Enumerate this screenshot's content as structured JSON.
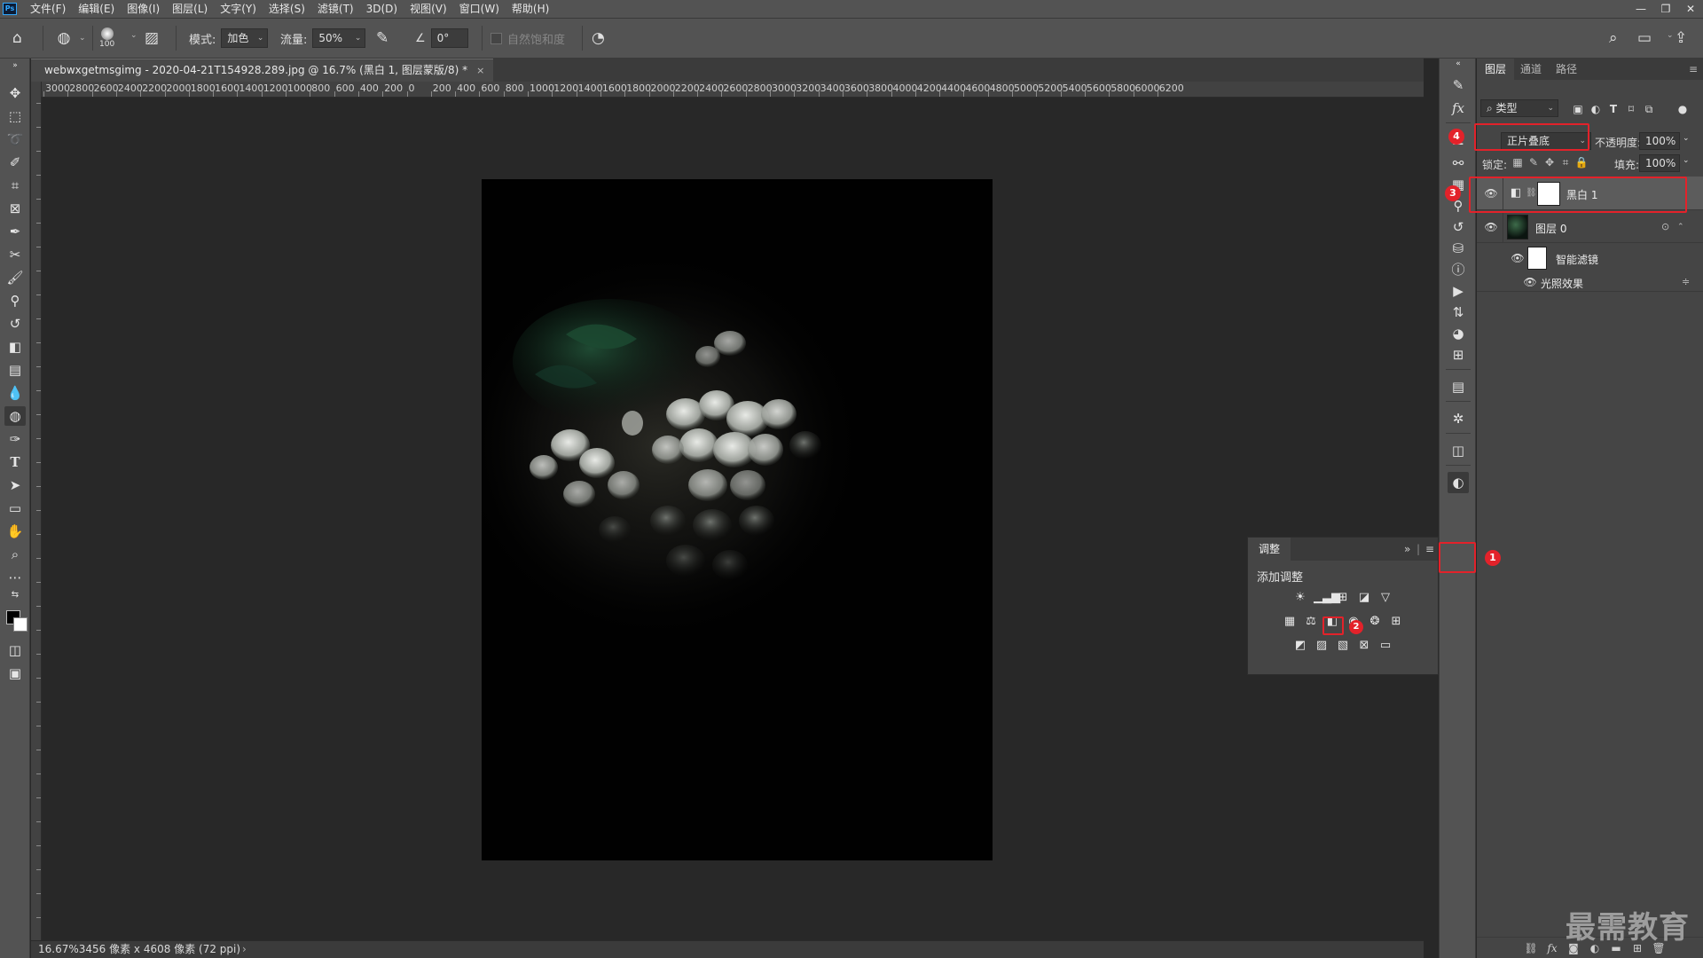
{
  "app": {
    "logo": "Ps"
  },
  "menubar": {
    "items": [
      "文件(F)",
      "编辑(E)",
      "图像(I)",
      "图层(L)",
      "文字(Y)",
      "选择(S)",
      "滤镜(T)",
      "3D(D)",
      "视图(V)",
      "窗口(W)",
      "帮助(H)"
    ],
    "window_controls": [
      "—",
      "❐",
      "✕"
    ]
  },
  "options": {
    "brush_size": "100",
    "mode_label": "模式:",
    "mode_value": "加色",
    "flow_label": "流量:",
    "flow_value": "50%",
    "angle_value": "0°",
    "saturation_label": "自然饱和度"
  },
  "document": {
    "tab_title": "webwxgetmsgimg - 2020-04-21T154928.289.jpg @ 16.7% (黑白 1, 图层蒙版/8) *",
    "close": "×",
    "ruler_labels": [
      "3000",
      "2800",
      "2600",
      "2400",
      "2200",
      "2000",
      "1800",
      "1600",
      "1400",
      "1200",
      "1000",
      "800",
      "600",
      "400",
      "200",
      "0",
      "200",
      "400",
      "600",
      "800",
      "1000",
      "1200",
      "1400",
      "1600",
      "1800",
      "2000",
      "2200",
      "2400",
      "2600",
      "2800",
      "3000",
      "3200",
      "3400",
      "3600",
      "3800",
      "4000",
      "4200",
      "4400",
      "4600",
      "4800",
      "5000",
      "5200",
      "5400",
      "5600",
      "5800",
      "6000",
      "6200"
    ],
    "status_zoom": "16.67%",
    "status_info": "3456 像素 x 4608 像素 (72 ppi)",
    "status_caret": "›"
  },
  "adjustments": {
    "tab": "调整",
    "collapse": "»",
    "menu": "≡",
    "subtitle": "添加调整",
    "rows": [
      [
        "brightness-contrast",
        "levels",
        "curves",
        "exposure",
        "vibrance"
      ],
      [
        "hue-saturation",
        "color-balance",
        "black-white",
        "photo-filter",
        "channel-mixer",
        "color-lookup"
      ],
      [
        "invert",
        "posterize",
        "threshold",
        "selective-color",
        "gradient-map"
      ]
    ]
  },
  "layers": {
    "tabs": [
      "图层",
      "通道",
      "路径"
    ],
    "filter_kind": "类型",
    "blend_mode": "正片叠底",
    "opacity_label": "不透明度:",
    "opacity_value": "100%",
    "lock_label": "锁定:",
    "fill_label": "填充:",
    "fill_value": "100%",
    "rows": [
      {
        "name": "黑白 1",
        "selected": true
      },
      {
        "name": "图层 0",
        "selected": false
      },
      {
        "name": "智能滤镜",
        "selected": false
      },
      {
        "name": "光照效果",
        "selected": false
      }
    ]
  },
  "steps": [
    "1",
    "2",
    "3",
    "4"
  ],
  "watermark": "最需教育",
  "colors": {
    "accent_red": "#e3222a",
    "panel_bg": "#454545",
    "ps_blue": "#31a8ff"
  }
}
